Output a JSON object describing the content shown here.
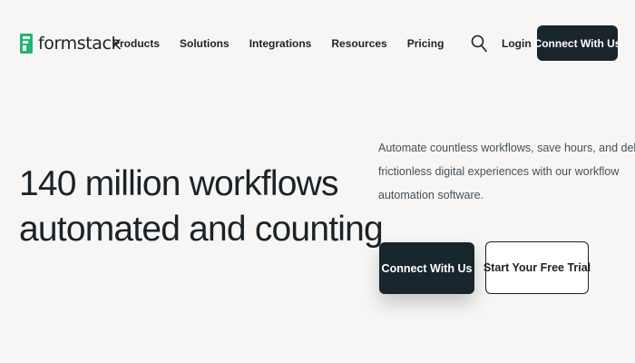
{
  "brand": {
    "name": "formstack",
    "accent": "#21b573",
    "dark": "#19252d",
    "logo_icon": "formstack-logo-icon"
  },
  "nav": {
    "links": [
      "Products",
      "Solutions",
      "Integrations",
      "Resources",
      "Pricing"
    ],
    "search_icon": "search-icon",
    "login": "Login",
    "cta": "Connect With Us"
  },
  "hero": {
    "headline_line1": "140 million workflows",
    "headline_line2": "automated and counting",
    "description_lines": [
      "Automate countless workflows, save hours, and deliver",
      "frictionless digital experiences with our workflow",
      "automation software."
    ],
    "primary_cta": "Connect With Us",
    "secondary_cta": "Start Your Free Trial"
  }
}
